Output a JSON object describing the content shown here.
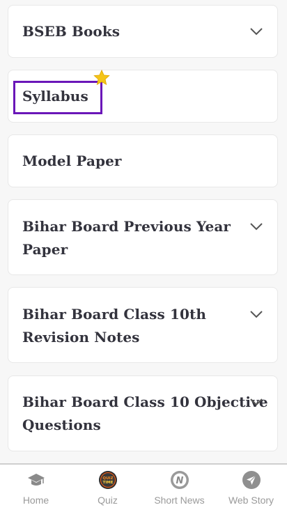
{
  "accordion": {
    "items": [
      {
        "title": "BSEB Books",
        "expandable": true
      },
      {
        "title": "Syllabus",
        "expandable": false
      },
      {
        "title": "Model Paper",
        "expandable": false
      },
      {
        "title_line1": "Bihar Board Previous Year",
        "title_line2": "Paper",
        "expandable": true
      },
      {
        "title_line1": "Bihar Board Class 10th",
        "title_line2": "Revision Notes",
        "expandable": true
      },
      {
        "title_line1": "Bihar Board Class 10 Objective",
        "title_line2": "Questions",
        "expandable": true
      }
    ]
  },
  "bottom_nav": {
    "items": [
      {
        "label": "Home",
        "icon": "graduation-cap-icon"
      },
      {
        "label": "Quiz",
        "icon": "quiz-time-icon",
        "icon_text": "QUIZ TIME"
      },
      {
        "label": "Short News",
        "icon": "news-n-icon",
        "icon_text": "N"
      },
      {
        "label": "Web Story",
        "icon": "paper-plane-icon"
      }
    ]
  },
  "colors": {
    "title_text": "#33333d",
    "highlight_border": "#6a16b8",
    "nav_text": "#9a9a9a",
    "star": "#f5c518"
  }
}
